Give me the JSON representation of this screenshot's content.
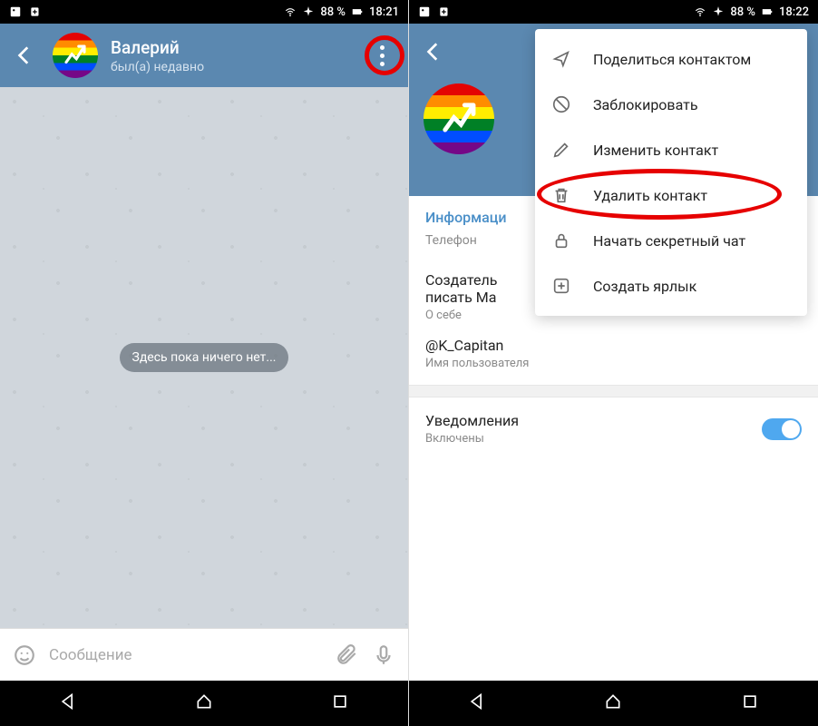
{
  "status": {
    "battery": "88 %",
    "time_left": "18:21",
    "time_right": "18:22"
  },
  "left": {
    "contact_name": "Валерий",
    "contact_status": "был(а) недавно",
    "empty_message": "Здесь пока ничего нет...",
    "input_placeholder": "Сообщение"
  },
  "right": {
    "section_info": "Информаци",
    "phone_label": "Телефон",
    "bio_line1": "Создатель",
    "bio_line2": "писать Ма",
    "bio_sub": "О себе",
    "username": "@K_Capitan",
    "username_label": "Имя пользователя",
    "notif_title": "Уведомления",
    "notif_status": "Включены"
  },
  "menu": {
    "share": "Поделиться контактом",
    "block": "Заблокировать",
    "edit": "Изменить контакт",
    "delete": "Удалить контакт",
    "secret": "Начать секретный чат",
    "shortcut": "Создать ярлык"
  }
}
